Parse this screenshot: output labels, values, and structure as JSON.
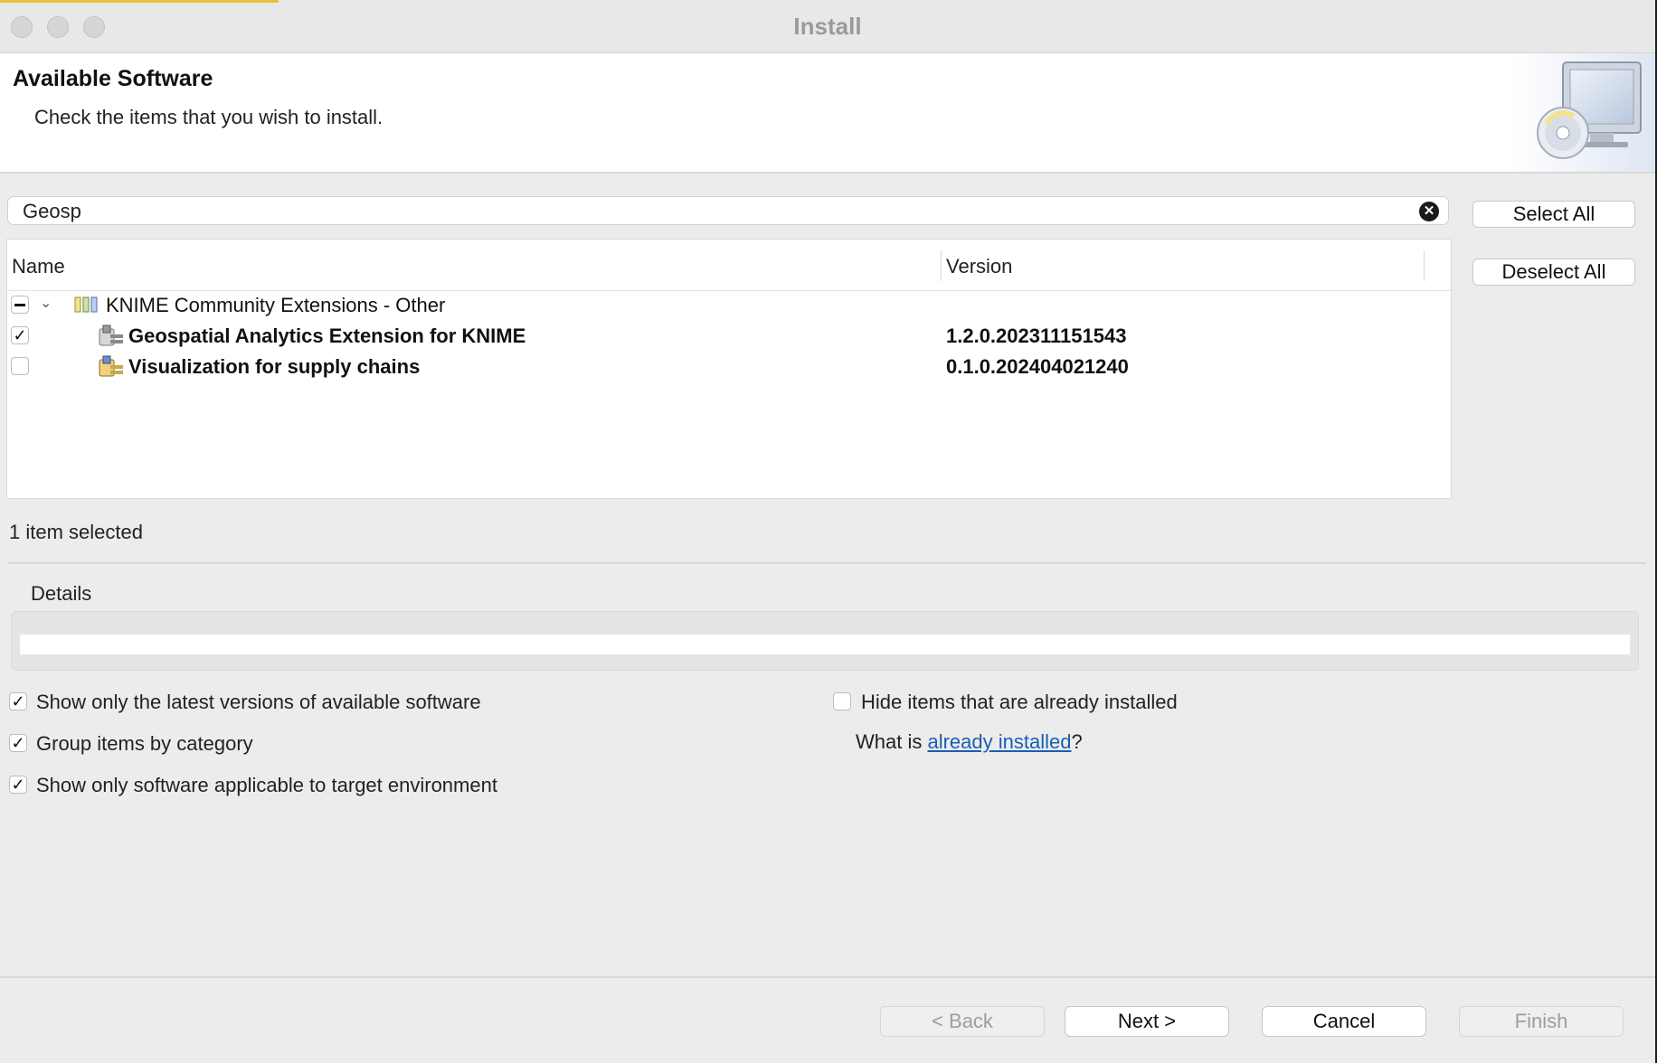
{
  "window": {
    "title": "Install"
  },
  "header": {
    "title": "Available Software",
    "subtitle": "Check the items that you wish to install.",
    "art_icon": "monitor-with-cd-icon"
  },
  "filter": {
    "value": "Geosp",
    "clear_icon": "clear-circle-icon"
  },
  "actions": {
    "select_all": "Select All",
    "deselect_all": "Deselect All"
  },
  "table": {
    "columns": {
      "name": "Name",
      "version": "Version"
    },
    "category": {
      "label": "KNIME Community Extensions - Other",
      "state": "partial",
      "expanded": true,
      "icon": "category-icon"
    },
    "items": [
      {
        "label": "Geospatial Analytics Extension for KNIME",
        "version": "1.2.0.202311151543",
        "checked": true,
        "icon": "feature-plugin-icon"
      },
      {
        "label": "Visualization for supply chains",
        "version": "0.1.0.202404021240",
        "checked": false,
        "icon": "feature-plugin-icon"
      }
    ]
  },
  "status": "1 item selected",
  "details": {
    "label": "Details",
    "text": ""
  },
  "options": {
    "latest_versions": {
      "label": "Show only the latest versions of available software",
      "checked": true
    },
    "group_by_category": {
      "label": "Group items by category",
      "checked": true
    },
    "applicable_only": {
      "label": "Show only software applicable to target environment",
      "checked": true
    },
    "hide_installed": {
      "label": "Hide items that are already installed",
      "checked": false
    },
    "what_is_prefix": "What is ",
    "what_is_link": "already installed",
    "what_is_suffix": "?"
  },
  "footer": {
    "back": "< Back",
    "next": "Next >",
    "cancel": "Cancel",
    "finish": "Finish"
  },
  "colors": {
    "link": "#1a5fb4",
    "accent": "#e8c13a"
  }
}
